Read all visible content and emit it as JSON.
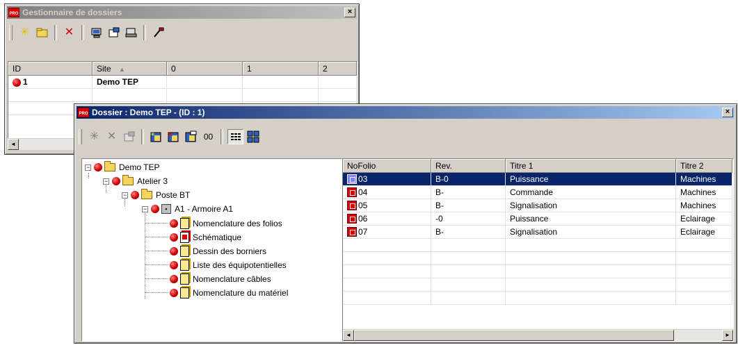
{
  "manager_window": {
    "title": "Gestionnaire de dossiers",
    "close_glyph": "×",
    "toolbar": [
      "new-icon",
      "open-folder-icon",
      "delete-icon",
      "computer-icon",
      "properties-icon",
      "scan-icon",
      "tools-icon"
    ],
    "columns": [
      "ID",
      "Site",
      "0",
      "1",
      "2"
    ],
    "sort_glyph": "▲",
    "rows": [
      {
        "id": "1",
        "site": "Demo TEP"
      }
    ]
  },
  "dossier_window": {
    "title": "Dossier : Demo TEP - (ID : 1)",
    "close_glyph": "×",
    "toolbar_extra_label": "00",
    "tree": {
      "root": "Demo TEP",
      "atelier": "Atelier 3",
      "poste": "Poste BT",
      "armoire": "A1 - Armoire A1",
      "documents": [
        "Nomenclature des folios",
        "Schématique",
        "Dessin des borniers",
        "Liste des équipotentielles",
        "Nomenclature câbles",
        "Nomenclature du matériel"
      ],
      "expand_glyph": "−"
    },
    "folio_columns": [
      "NoFolio",
      "Rev.",
      "Titre 1",
      "Titre 2"
    ],
    "folios": [
      {
        "no": "03",
        "rev": "B-0",
        "titre1": "Puissance",
        "titre2": "Machines"
      },
      {
        "no": "04",
        "rev": "B-",
        "titre1": "Commande",
        "titre2": "Machines"
      },
      {
        "no": "05",
        "rev": "B-",
        "titre1": "Signalisation",
        "titre2": "Machines"
      },
      {
        "no": "06",
        "rev": "-0",
        "titre1": "Puissance",
        "titre2": "Eclairage"
      },
      {
        "no": "07",
        "rev": "B-",
        "titre1": "Signalisation",
        "titre2": "Eclairage"
      }
    ],
    "scroll_left": "◄",
    "scroll_right": "►"
  }
}
